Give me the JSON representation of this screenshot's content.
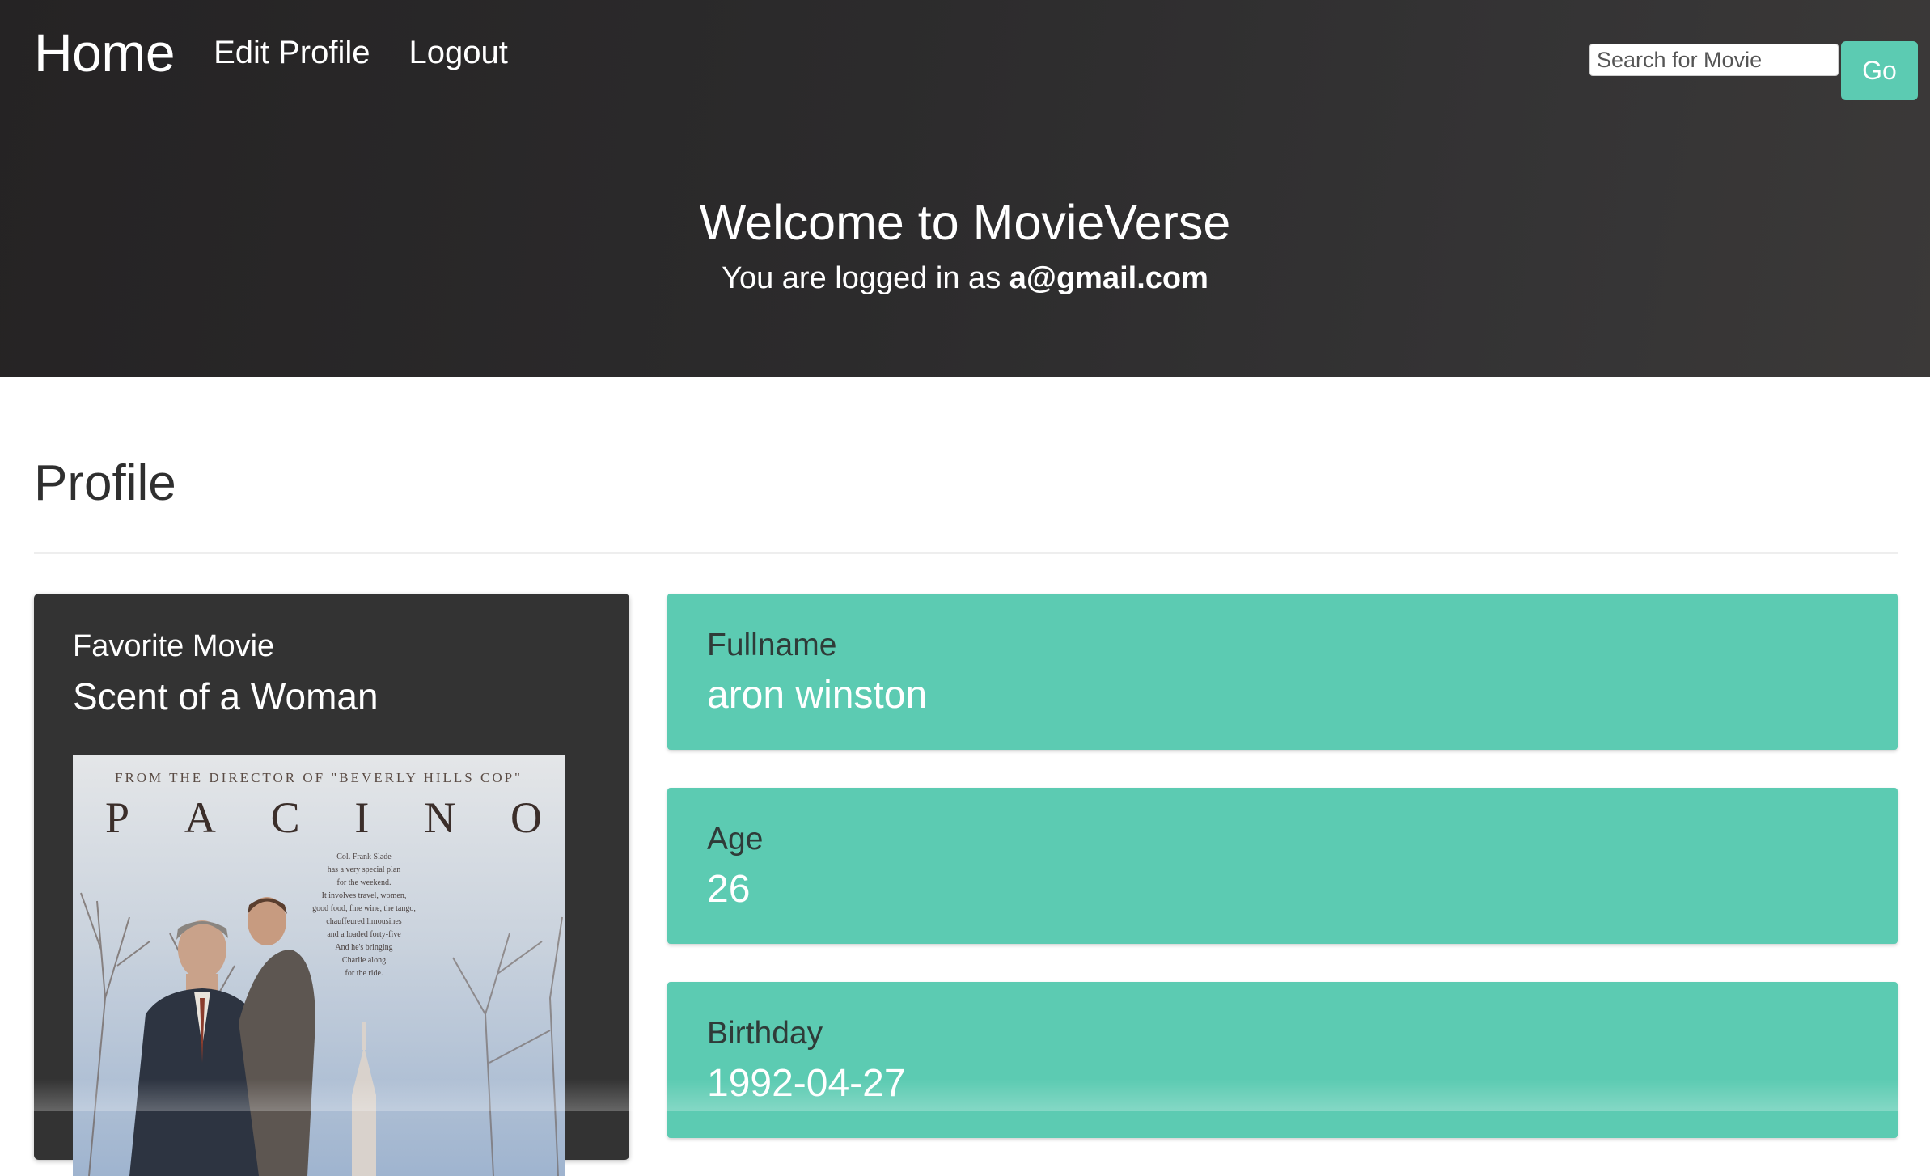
{
  "nav": {
    "brand": "Home",
    "links": [
      "Edit Profile",
      "Logout"
    ],
    "search_placeholder": "Search for Movie",
    "search_button": "Go"
  },
  "hero": {
    "title": "Welcome to MovieVerse",
    "subtitle_prefix": "You are logged in as",
    "email": "a@gmail.com"
  },
  "profile": {
    "heading": "Profile",
    "favorite_movie": {
      "label": "Favorite Movie",
      "title": "Scent of a Woman",
      "poster": {
        "top_line": "FROM THE DIRECTOR OF \"BEVERLY HILLS COP\"",
        "name_letters": [
          "P",
          "A",
          "C",
          "I",
          "N",
          "O"
        ],
        "blurb": [
          "Col. Frank Slade",
          "has a very special plan",
          "for the weekend.",
          "It involves travel, women,",
          "good food, fine wine, the tango,",
          "chauffeured limousines",
          "and a loaded forty-five",
          "And he's bringing",
          "Charlie along",
          "for the ride."
        ]
      }
    },
    "fields": [
      {
        "label": "Fullname",
        "value": "aron winston"
      },
      {
        "label": "Age",
        "value": "26"
      },
      {
        "label": "Birthday",
        "value": "1992-04-27"
      }
    ]
  },
  "colors": {
    "accent": "#5ccbb2",
    "hero_background": "#2c2b2c",
    "card_dark": "#333333"
  }
}
